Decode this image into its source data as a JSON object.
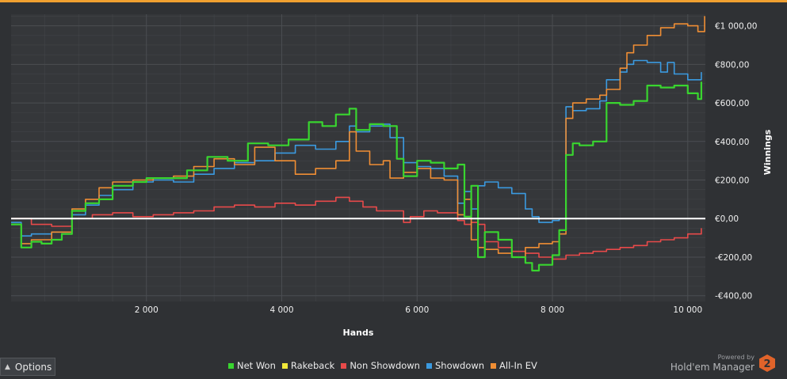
{
  "chart_data": {
    "type": "line",
    "xlabel": "Hands",
    "ylabel": "Winnings",
    "xlim": [
      0,
      10260
    ],
    "ylim": [
      -430,
      1060
    ],
    "x_ticks": [
      2000,
      4000,
      6000,
      8000,
      10000
    ],
    "x_tick_labels": [
      "2 000",
      "4 000",
      "6 000",
      "8 000",
      "10 000"
    ],
    "y_ticks": [
      -400,
      -200,
      0,
      200,
      400,
      600,
      800,
      1000
    ],
    "y_tick_labels": [
      "-€400,00",
      "-€200,00",
      "€0,00",
      "€200,00",
      "€400,00",
      "€600,00",
      "€800,00",
      "€1 000,00"
    ],
    "grid": true,
    "legend_position": "bottom",
    "series": [
      {
        "name": "Net Won",
        "color": "#39d52f",
        "x": [
          0,
          150,
          300,
          450,
          600,
          750,
          900,
          1100,
          1300,
          1500,
          1800,
          2000,
          2300,
          2600,
          2900,
          3200,
          3500,
          3800,
          4100,
          4400,
          4600,
          4800,
          5000,
          5100,
          5300,
          5500,
          5700,
          5800,
          6000,
          6200,
          6400,
          6600,
          6700,
          6800,
          6900,
          7000,
          7200,
          7400,
          7600,
          7700,
          7800,
          8000,
          8100,
          8200,
          8300,
          8400,
          8600,
          8800,
          9000,
          9200,
          9400,
          9600,
          9800,
          10000,
          10150,
          10200
        ],
        "y": [
          -30,
          -150,
          -120,
          -130,
          -110,
          -80,
          40,
          80,
          100,
          170,
          190,
          210,
          210,
          250,
          320,
          300,
          390,
          380,
          410,
          500,
          480,
          540,
          570,
          460,
          490,
          480,
          310,
          220,
          300,
          290,
          260,
          280,
          10,
          170,
          -200,
          -70,
          -110,
          -200,
          -230,
          -270,
          -240,
          -190,
          -60,
          330,
          390,
          380,
          400,
          600,
          590,
          610,
          690,
          680,
          690,
          650,
          620,
          710
        ]
      },
      {
        "name": "Rakeback",
        "color": "#f1e83a",
        "x": [],
        "y": []
      },
      {
        "name": "Non Showdown",
        "color": "#e84a4a",
        "x": [
          0,
          300,
          600,
          900,
          1200,
          1500,
          1800,
          2100,
          2400,
          2700,
          3000,
          3300,
          3600,
          3900,
          4200,
          4500,
          4800,
          5000,
          5200,
          5400,
          5600,
          5800,
          5900,
          6100,
          6300,
          6500,
          6600,
          6700,
          6800,
          6900,
          7000,
          7200,
          7400,
          7600,
          7800,
          8000,
          8200,
          8400,
          8600,
          8800,
          9000,
          9200,
          9400,
          9600,
          9800,
          10000,
          10200
        ],
        "y": [
          0,
          -30,
          -40,
          0,
          20,
          30,
          10,
          20,
          30,
          40,
          60,
          70,
          60,
          80,
          70,
          90,
          110,
          90,
          60,
          40,
          40,
          -20,
          10,
          40,
          30,
          30,
          -10,
          -30,
          -20,
          -30,
          -120,
          -150,
          -170,
          -180,
          -200,
          -210,
          -190,
          -180,
          -170,
          -160,
          -150,
          -140,
          -120,
          -110,
          -100,
          -80,
          -50
        ]
      },
      {
        "name": "Showdown",
        "color": "#3b9ae0",
        "x": [
          0,
          150,
          300,
          600,
          900,
          1100,
          1300,
          1500,
          1800,
          2100,
          2400,
          2700,
          3000,
          3300,
          3600,
          3900,
          4200,
          4500,
          4800,
          5000,
          5100,
          5300,
          5500,
          5600,
          5800,
          6000,
          6200,
          6400,
          6600,
          6700,
          6800,
          6900,
          7000,
          7200,
          7400,
          7600,
          7700,
          7800,
          8000,
          8100,
          8200,
          8300,
          8500,
          8700,
          8800,
          9000,
          9100,
          9200,
          9400,
          9600,
          9700,
          9800,
          10000,
          10200
        ],
        "y": [
          -20,
          -90,
          -80,
          -70,
          20,
          70,
          120,
          150,
          190,
          200,
          190,
          230,
          260,
          290,
          300,
          340,
          380,
          360,
          400,
          480,
          450,
          480,
          490,
          420,
          290,
          270,
          260,
          220,
          80,
          140,
          50,
          170,
          190,
          160,
          130,
          50,
          10,
          -20,
          -10,
          0,
          580,
          560,
          570,
          610,
          720,
          760,
          800,
          820,
          810,
          760,
          810,
          750,
          720,
          760
        ]
      },
      {
        "name": "All-In EV",
        "color": "#f08e34",
        "x": [
          0,
          150,
          300,
          600,
          900,
          1100,
          1300,
          1500,
          1800,
          2100,
          2400,
          2700,
          3000,
          3300,
          3600,
          3900,
          4200,
          4500,
          4800,
          5000,
          5100,
          5300,
          5500,
          5600,
          5800,
          6000,
          6200,
          6400,
          6600,
          6700,
          6800,
          6900,
          7000,
          7200,
          7400,
          7600,
          7800,
          8000,
          8100,
          8200,
          8300,
          8500,
          8700,
          8800,
          9000,
          9100,
          9200,
          9400,
          9600,
          9700,
          9800,
          10000,
          10150,
          10250
        ],
        "y": [
          -30,
          -130,
          -110,
          -70,
          50,
          100,
          160,
          190,
          200,
          210,
          220,
          270,
          310,
          280,
          370,
          300,
          230,
          260,
          300,
          450,
          350,
          280,
          300,
          210,
          240,
          260,
          210,
          200,
          20,
          100,
          -110,
          -150,
          -160,
          -180,
          -200,
          -150,
          -130,
          -120,
          -80,
          520,
          600,
          620,
          640,
          670,
          780,
          860,
          900,
          950,
          990,
          990,
          1010,
          1000,
          970,
          1050
        ]
      }
    ]
  },
  "legend": [
    {
      "label": "Net Won",
      "color": "#39d52f"
    },
    {
      "label": "Rakeback",
      "color": "#f1e83a"
    },
    {
      "label": "Non Showdown",
      "color": "#e84a4a"
    },
    {
      "label": "Showdown",
      "color": "#3b9ae0"
    },
    {
      "label": "All-In EV",
      "color": "#f08e34"
    }
  ],
  "options_label": "Options",
  "branding": {
    "powered_by": "Powered by",
    "product": "Hold'em Manager",
    "logo_text": "2",
    "logo_color": "#e0632a"
  },
  "theme": {
    "background": "#2f3134",
    "plot_background": "#35373a",
    "grid": "#4b4e52",
    "zero_line": "#ffffff",
    "accent": "#f0a030"
  }
}
